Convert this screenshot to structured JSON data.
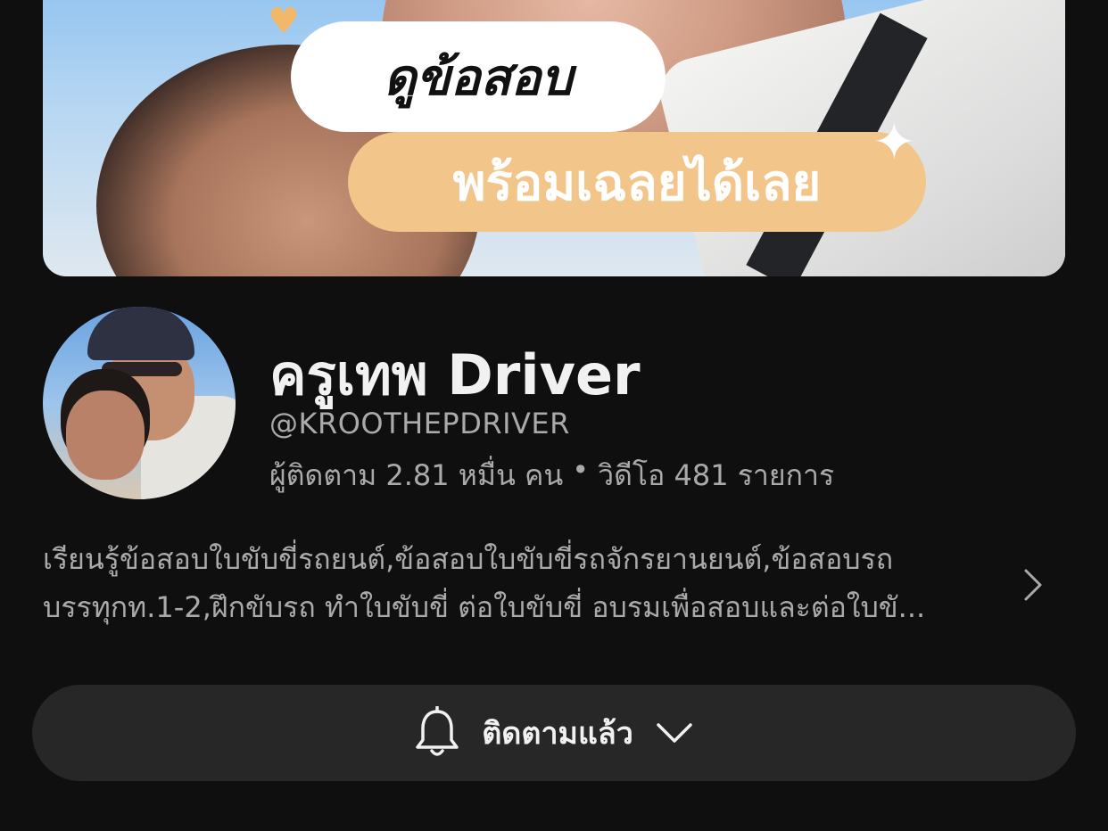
{
  "banner": {
    "line1": "ดูข้อสอบ",
    "line2": "พร้อมเฉลยได้เลย",
    "heart_icon": "heart-icon",
    "sparkle_icon": "sparkle-icon",
    "accent": "#f2c58a"
  },
  "channel": {
    "name": "ครูเทพ Driver",
    "handle": "@KROOTHEPDRIVER",
    "subscribers": "ผู้ติดตาม 2.81 หมื่น คน",
    "separator": "•",
    "videos": "วิดีโอ 481 รายการ"
  },
  "description": {
    "line1": "เรียนรู้ข้อสอบใบขับขี่รถยนต์,ข้อสอบใบขับขี่รถจักรยานยนต์,ข้อสอบรถ",
    "line2": "บรรทุกท.1-2,ฝึกขับรถ ทำใบขับขี่ ต่อใบขับขี่ อบรมเพื่อสอบและต่อใบขั...",
    "expand_icon": "chevron-right-icon"
  },
  "subscribe_button": {
    "label": "ติดตามแล้ว",
    "bell_icon": "bell-icon",
    "dropdown_icon": "chevron-down-icon"
  },
  "colors": {
    "background": "#0f0f0f",
    "button_bg": "#272727",
    "primary_text": "#f1f1f1",
    "secondary_text": "#aaaaaa"
  }
}
